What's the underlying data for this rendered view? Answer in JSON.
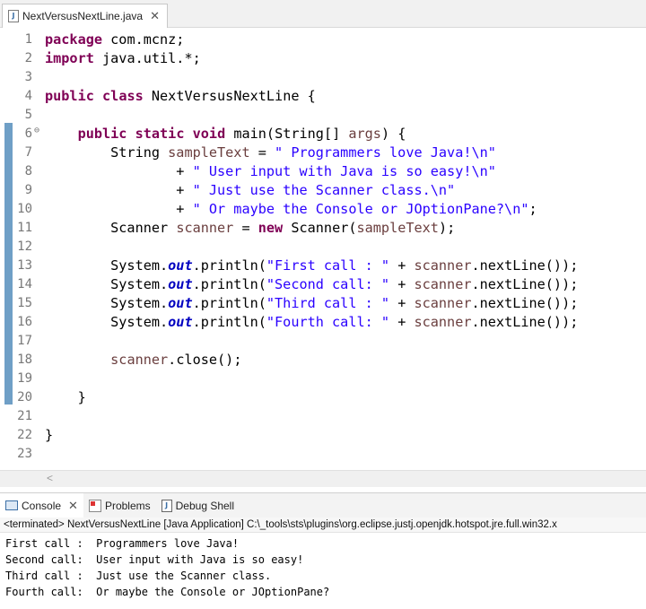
{
  "editor_tab": {
    "label": "NextVersusNextLine.java",
    "icon": "java-file-icon"
  },
  "code_lines": [
    {
      "n": "1",
      "parts": [
        {
          "t": "package",
          "c": "kw"
        },
        {
          "t": " com.mcnz;",
          "c": ""
        }
      ]
    },
    {
      "n": "2",
      "parts": [
        {
          "t": "import",
          "c": "kw"
        },
        {
          "t": " java.util.*;",
          "c": ""
        }
      ]
    },
    {
      "n": "3",
      "parts": []
    },
    {
      "n": "4",
      "parts": [
        {
          "t": "public",
          "c": "kw"
        },
        {
          "t": " ",
          "c": ""
        },
        {
          "t": "class",
          "c": "kw"
        },
        {
          "t": " NextVersusNextLine {",
          "c": ""
        }
      ]
    },
    {
      "n": "5",
      "parts": []
    },
    {
      "n": "6",
      "fold": true,
      "parts": [
        {
          "t": "    ",
          "c": ""
        },
        {
          "t": "public",
          "c": "kw"
        },
        {
          "t": " ",
          "c": ""
        },
        {
          "t": "static",
          "c": "kw"
        },
        {
          "t": " ",
          "c": ""
        },
        {
          "t": "void",
          "c": "kw"
        },
        {
          "t": " main(String[] ",
          "c": ""
        },
        {
          "t": "args",
          "c": "var"
        },
        {
          "t": ") {",
          "c": ""
        }
      ]
    },
    {
      "n": "7",
      "parts": [
        {
          "t": "        String ",
          "c": ""
        },
        {
          "t": "sampleText",
          "c": "var"
        },
        {
          "t": " = ",
          "c": ""
        },
        {
          "t": "\" Programmers love Java!\\n\"",
          "c": "str"
        }
      ]
    },
    {
      "n": "8",
      "parts": [
        {
          "t": "                + ",
          "c": ""
        },
        {
          "t": "\" User input with Java is so easy!\\n\"",
          "c": "str"
        }
      ]
    },
    {
      "n": "9",
      "parts": [
        {
          "t": "                + ",
          "c": ""
        },
        {
          "t": "\" Just use the Scanner class.\\n\"",
          "c": "str"
        }
      ]
    },
    {
      "n": "10",
      "parts": [
        {
          "t": "                + ",
          "c": ""
        },
        {
          "t": "\" Or maybe the Console or JOptionPane?\\n\"",
          "c": "str"
        },
        {
          "t": ";",
          "c": ""
        }
      ]
    },
    {
      "n": "11",
      "parts": [
        {
          "t": "        Scanner ",
          "c": ""
        },
        {
          "t": "scanner",
          "c": "var"
        },
        {
          "t": " = ",
          "c": ""
        },
        {
          "t": "new",
          "c": "kw"
        },
        {
          "t": " Scanner(",
          "c": ""
        },
        {
          "t": "sampleText",
          "c": "var"
        },
        {
          "t": ");",
          "c": ""
        }
      ]
    },
    {
      "n": "12",
      "parts": []
    },
    {
      "n": "13",
      "parts": [
        {
          "t": "        System.",
          "c": ""
        },
        {
          "t": "out",
          "c": "fld"
        },
        {
          "t": ".println(",
          "c": ""
        },
        {
          "t": "\"First call : \"",
          "c": "str"
        },
        {
          "t": " + ",
          "c": ""
        },
        {
          "t": "scanner",
          "c": "var"
        },
        {
          "t": ".nextLine());",
          "c": ""
        }
      ]
    },
    {
      "n": "14",
      "parts": [
        {
          "t": "        System.",
          "c": ""
        },
        {
          "t": "out",
          "c": "fld"
        },
        {
          "t": ".println(",
          "c": ""
        },
        {
          "t": "\"Second call: \"",
          "c": "str"
        },
        {
          "t": " + ",
          "c": ""
        },
        {
          "t": "scanner",
          "c": "var"
        },
        {
          "t": ".nextLine());",
          "c": ""
        }
      ]
    },
    {
      "n": "15",
      "parts": [
        {
          "t": "        System.",
          "c": ""
        },
        {
          "t": "out",
          "c": "fld"
        },
        {
          "t": ".println(",
          "c": ""
        },
        {
          "t": "\"Third call : \"",
          "c": "str"
        },
        {
          "t": " + ",
          "c": ""
        },
        {
          "t": "scanner",
          "c": "var"
        },
        {
          "t": ".nextLine());",
          "c": ""
        }
      ]
    },
    {
      "n": "16",
      "parts": [
        {
          "t": "        System.",
          "c": ""
        },
        {
          "t": "out",
          "c": "fld"
        },
        {
          "t": ".println(",
          "c": ""
        },
        {
          "t": "\"Fourth call: \"",
          "c": "str"
        },
        {
          "t": " + ",
          "c": ""
        },
        {
          "t": "scanner",
          "c": "var"
        },
        {
          "t": ".nextLine());",
          "c": ""
        }
      ]
    },
    {
      "n": "17",
      "parts": []
    },
    {
      "n": "18",
      "parts": [
        {
          "t": "        ",
          "c": ""
        },
        {
          "t": "scanner",
          "c": "var"
        },
        {
          "t": ".close();",
          "c": ""
        }
      ]
    },
    {
      "n": "19",
      "parts": []
    },
    {
      "n": "20",
      "parts": [
        {
          "t": "    }",
          "c": ""
        }
      ]
    },
    {
      "n": "21",
      "parts": []
    },
    {
      "n": "22",
      "parts": [
        {
          "t": "}",
          "c": ""
        }
      ]
    },
    {
      "n": "23",
      "parts": []
    }
  ],
  "console_tabs": [
    {
      "label": "Console",
      "icon": "console-icon",
      "active": true,
      "closable": true
    },
    {
      "label": "Problems",
      "icon": "problems-icon",
      "active": false
    },
    {
      "label": "Debug Shell",
      "icon": "debug-shell-icon",
      "active": false
    }
  ],
  "console_status": "<terminated> NextVersusNextLine [Java Application] C:\\_tools\\sts\\plugins\\org.eclipse.justj.openjdk.hotspot.jre.full.win32.x",
  "console_output": [
    "First call :  Programmers love Java!",
    "Second call:  User input with Java is so easy!",
    "Third call :  Just use the Scanner class.",
    "Fourth call:  Or maybe the Console or JOptionPane?"
  ],
  "colors": {
    "keyword": "#7f0055",
    "string": "#2a00ff",
    "field": "#0000c0",
    "variable": "#6a3e3e",
    "change_bar": "#6f9fc6"
  }
}
